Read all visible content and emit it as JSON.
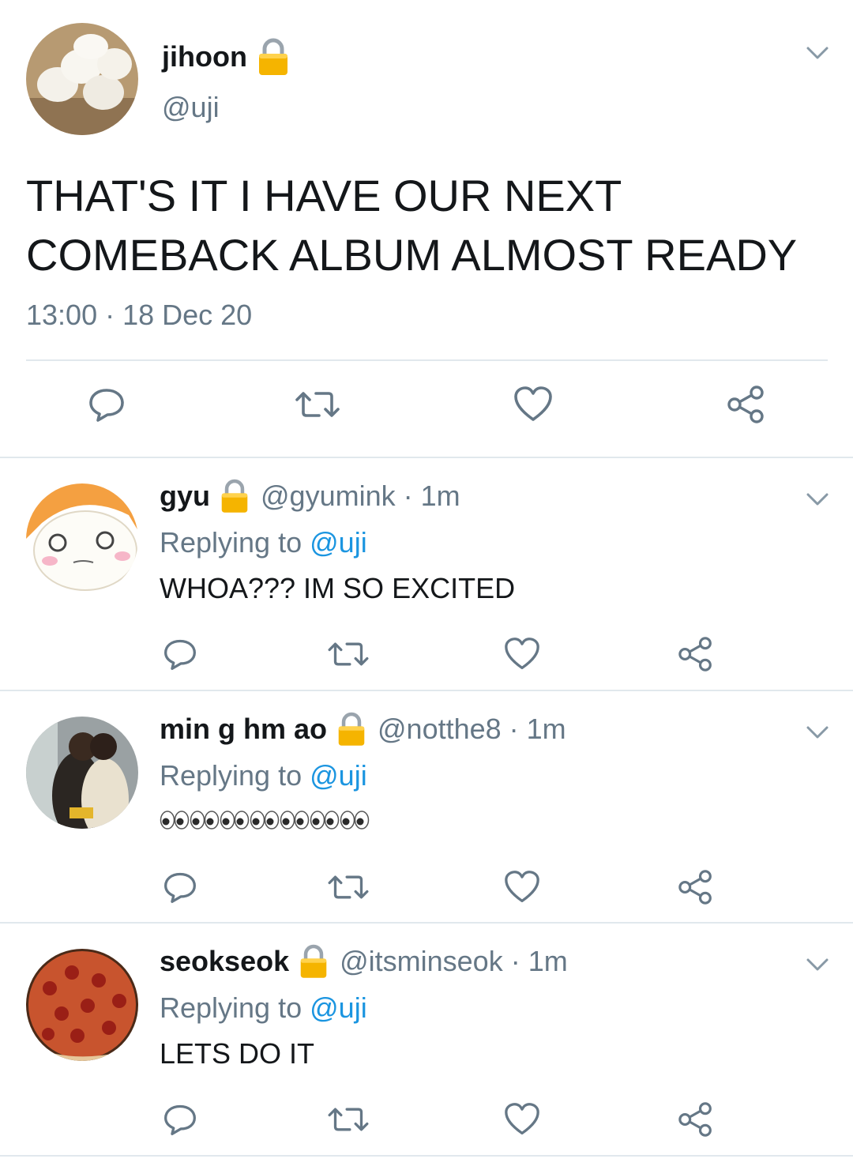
{
  "main_tweet": {
    "display_name": "jihoon",
    "handle": "@uji",
    "text": "THAT'S IT I HAVE OUR NEXT COMEBACK ALBUM ALMOST READY",
    "timestamp": "13:00 · 18 Dec 20"
  },
  "replies": [
    {
      "display_name": "gyu",
      "handle_time": "@gyumink · 1m",
      "replying_label": "Replying to",
      "replying_to": "@uji",
      "text": "WHOA??? IM SO EXCITED"
    },
    {
      "display_name": "min g hm ao",
      "handle_time": "@notthe8 · 1m",
      "replying_label": "Replying to",
      "replying_to": "@uji",
      "text": "👀👀👀👀👀👀👀"
    },
    {
      "display_name": "seokseok",
      "handle_time": "@itsminseok · 1m",
      "replying_label": "Replying to",
      "replying_to": "@uji",
      "text": "LETS DO IT"
    }
  ],
  "icons": {
    "lock": "lock-icon",
    "chevron": "chevron-down-icon",
    "reply": "reply-icon",
    "retweet": "retweet-icon",
    "like": "heart-icon",
    "share": "share-icon"
  },
  "colors": {
    "text": "#14171a",
    "secondary": "#657786",
    "link": "#1b95e0",
    "divider": "#e1e8ed",
    "lock": "#f5b400"
  }
}
